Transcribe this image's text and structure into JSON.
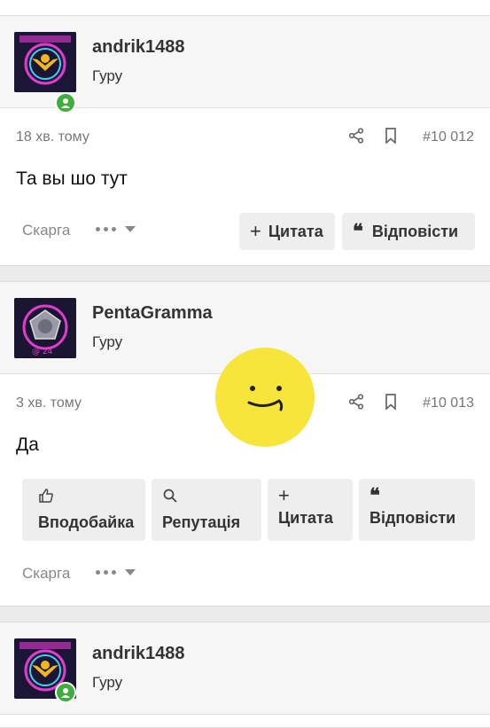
{
  "posts": [
    {
      "author": "andrik1488",
      "rank": "Гуру",
      "time": "18 хв. тому",
      "number": "#10 012",
      "text": "Та вы шо тут",
      "report": "Скарга",
      "quote": "Цитата",
      "reply": "Відповісти"
    },
    {
      "author": "PentaGramma",
      "rank": "Гуру",
      "time": "3 хв. тому",
      "number": "#10 013",
      "text": "Да",
      "report": "Скарга",
      "like": "Вподобайка",
      "reputation": "Репутація",
      "quote": "Цитата",
      "reply": "Відповісти"
    },
    {
      "author": "andrik1488",
      "rank": "Гуру"
    }
  ],
  "colors": {
    "online": "#3fae3f",
    "sticker": "#f8e53c",
    "button_bg": "#eeeeee"
  },
  "icons": [
    "share-icon",
    "bookmark-icon",
    "plus-icon",
    "quote-icon",
    "thumbs-up-icon",
    "search-icon",
    "chevron-down-icon",
    "online-user-icon"
  ]
}
